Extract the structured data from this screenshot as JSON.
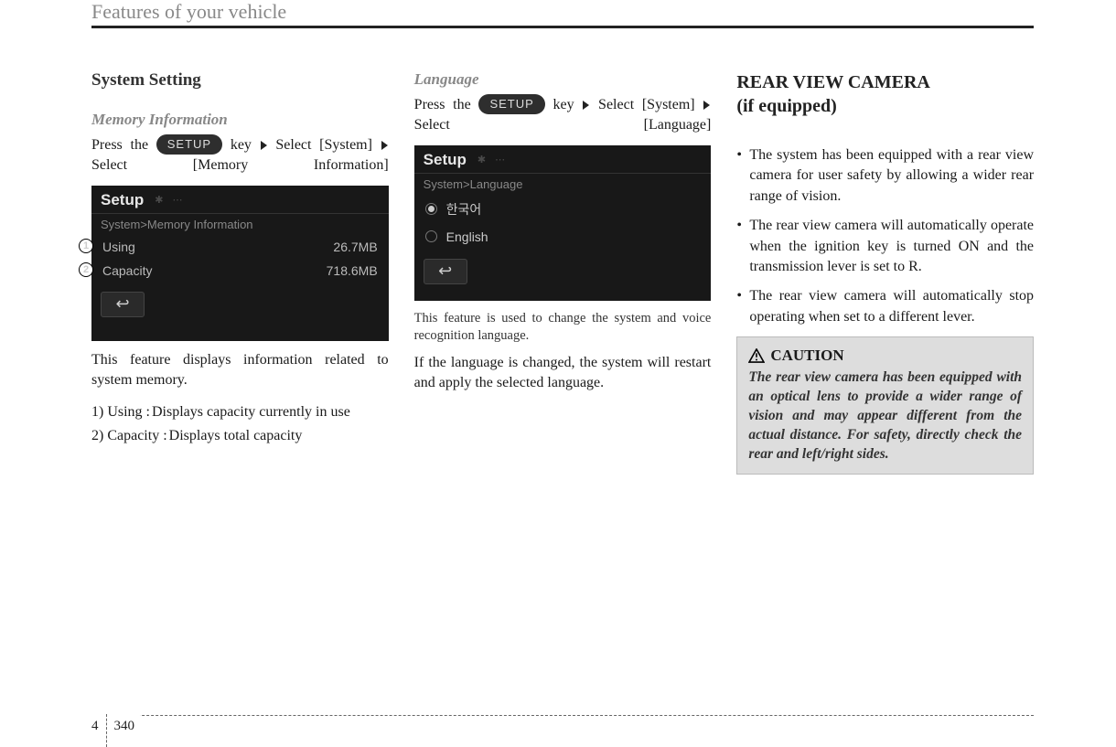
{
  "header": "Features of your vehicle",
  "footer": {
    "chapter": "4",
    "page": "340"
  },
  "col1": {
    "heading": "System Setting",
    "sub": "Memory Information",
    "instr_pre1": "Press the ",
    "setup_label": "SETUP",
    "instr_key": " key",
    "instr_sel1": "Select [System]",
    "instr_sel2": "Select [Memory Information]",
    "screenshot": {
      "title": "Setup",
      "breadcrumb": "System>Memory Information",
      "rows": [
        {
          "label": "Using",
          "value": "26.7MB"
        },
        {
          "label": "Capacity",
          "value": "718.6MB"
        }
      ],
      "callouts": [
        "1",
        "2"
      ]
    },
    "body1": "This feature displays information related to system memory.",
    "list": [
      {
        "num": "1) Using :",
        "text": "Displays capacity currently in use"
      },
      {
        "num": "2) Capacity :",
        "text": "Displays total capacity"
      }
    ]
  },
  "col2": {
    "sub": "Language",
    "instr_pre1": "Press the ",
    "setup_label": "SETUP",
    "instr_key": " key",
    "instr_sel1": "Select [System]",
    "instr_sel2": "Select [Language]",
    "screenshot": {
      "title": "Setup",
      "breadcrumb": "System>Language",
      "options": [
        {
          "label": "한국어",
          "selected": true
        },
        {
          "label": "English",
          "selected": false
        }
      ]
    },
    "small1": "This feature is used to change the system and voice recognition language.",
    "body1": "If the language is changed, the system will restart and apply the selected language."
  },
  "col3": {
    "heading_line1": "REAR VIEW CAMERA",
    "heading_line2": "(if equipped)",
    "bullets": [
      "The system has been equipped with a rear view camera for user safety by allowing a wider rear range of vision.",
      "The rear view camera will automatically operate when the ignition key is turned ON and the transmission lever is set to R.",
      "The rear view camera will automatically stop operating when set to a different lever."
    ],
    "caution_label": "CAUTION",
    "caution_body": "The rear view camera has been equipped with an optical lens to provide a wider range of vision and may appear different from the actual distance. For safety, directly check the rear and left/right sides."
  }
}
